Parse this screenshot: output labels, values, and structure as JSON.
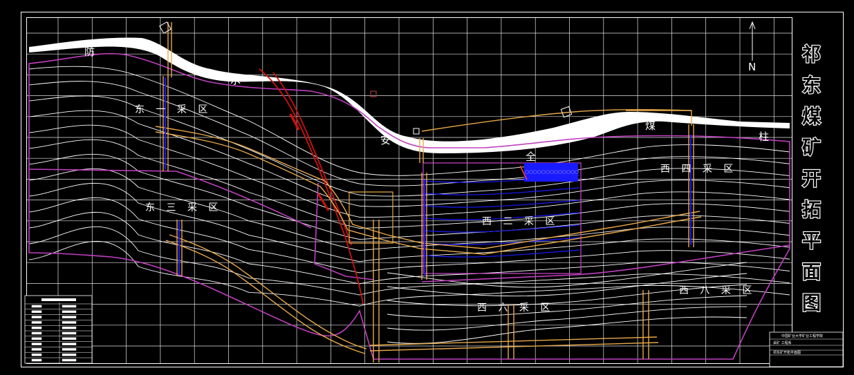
{
  "drawing": {
    "title_chars": [
      "祁",
      "东",
      "煤",
      "矿",
      "开",
      "拓",
      "平",
      "面",
      "图"
    ],
    "north_label": "N",
    "slogan": [
      "防",
      "水",
      "安",
      "全",
      "煤",
      "柱"
    ],
    "areas": {
      "east1": "东 一 采 区",
      "east3": "东 三 采 区",
      "west2": "西 二 采 区",
      "west4": "西 四 采 区",
      "west6": "西 六 采 区",
      "west8": "西 八 采 区"
    },
    "title_block": {
      "line1": "中国矿业大学矿业工程学院",
      "line2": "采矿 工程系",
      "line3": "祁东矿开拓平面图"
    },
    "colors": {
      "background": "#000000",
      "roadway": "#e8a94a",
      "boundary": "#c040c0",
      "fault": "#d01010",
      "workface": "#1a1aff",
      "contour": "#ffffff"
    }
  }
}
